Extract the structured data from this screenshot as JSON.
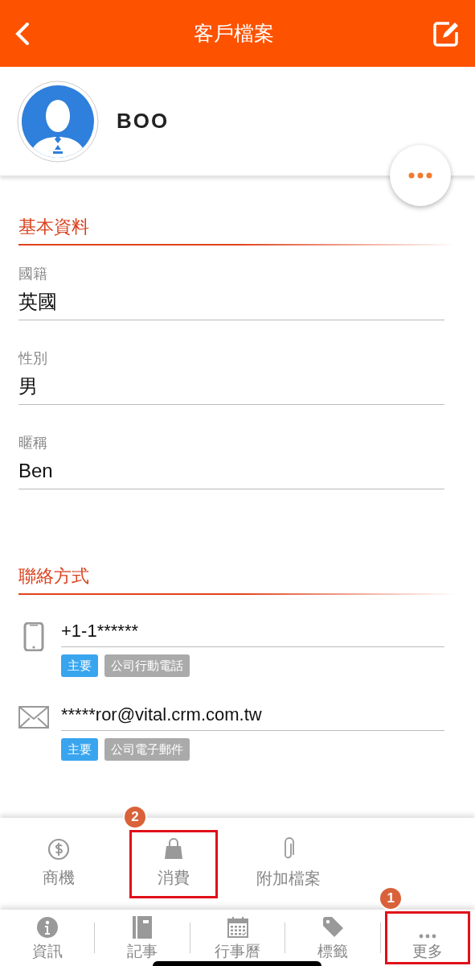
{
  "header": {
    "title": "客戶檔案"
  },
  "profile": {
    "name": "BOO"
  },
  "basic": {
    "title": "基本資料",
    "fields": [
      {
        "label": "國籍",
        "value": "英國"
      },
      {
        "label": "性別",
        "value": "男"
      },
      {
        "label": "暱稱",
        "value": "Ben"
      }
    ]
  },
  "contact": {
    "title": "聯絡方式",
    "items": [
      {
        "kind": "phone",
        "value": "+1-1******",
        "tags": [
          {
            "text": "主要",
            "kind": "primary"
          },
          {
            "text": "公司行動電話",
            "kind": "type"
          }
        ]
      },
      {
        "kind": "email",
        "value": "*****ror@vital.crm.com.tw",
        "tags": [
          {
            "text": "主要",
            "kind": "primary"
          },
          {
            "text": "公司電子郵件",
            "kind": "type"
          }
        ]
      }
    ]
  },
  "more_menu": {
    "items": [
      {
        "kind": "dollar",
        "label": "商機"
      },
      {
        "kind": "bag",
        "label": "消費",
        "annotation": "2"
      },
      {
        "kind": "clip",
        "label": "附加檔案"
      }
    ]
  },
  "tab_bar": {
    "items": [
      {
        "kind": "info",
        "label": "資訊"
      },
      {
        "kind": "notebook",
        "label": "記事"
      },
      {
        "kind": "calendar",
        "label": "行事曆"
      },
      {
        "kind": "tag",
        "label": "標籤"
      },
      {
        "kind": "more",
        "label": "更多",
        "annotation": "1"
      }
    ]
  }
}
